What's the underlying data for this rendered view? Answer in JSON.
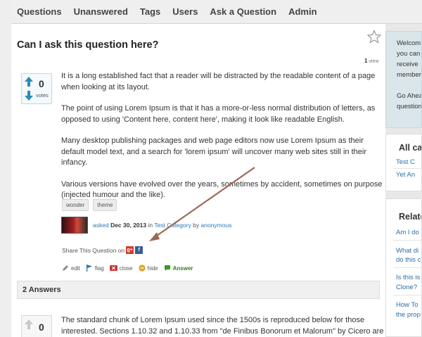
{
  "nav": {
    "items": [
      "Questions",
      "Unanswered",
      "Tags",
      "Users",
      "Ask a Question",
      "Admin"
    ]
  },
  "question": {
    "title": "Can I ask this question here?",
    "views_count": "1",
    "views_label": "view",
    "votes": "0",
    "votes_label": "votes",
    "paragraphs": [
      "It is a long established fact that a reader will be distracted by the readable content of a page when looking at its layout.",
      "The point of using Lorem Ipsum is that it has a more-or-less normal distribution of letters, as opposed to using 'Content here, content here', making it look like readable English.",
      "Many desktop publishing packages and web page editors now use Lorem Ipsum as their default model text, and a search for 'lorem ipsum' will uncover many web sites still in their infancy.",
      "Various versions have evolved over the years, sometimes by accident, sometimes on purpose (injected humour and the like)."
    ],
    "tags": [
      "wonder",
      "theme"
    ],
    "asked": {
      "label": "asked",
      "date": "Dec 30, 2013",
      "in": "in",
      "category": "Test Category",
      "by": "by",
      "user": "anonymous"
    },
    "share_label": "Share This Question on",
    "actions": {
      "edit": "edit",
      "flag": "flag",
      "close": "close",
      "hide": "hide",
      "answer": "Answer"
    }
  },
  "answers": {
    "header": "2 Answers",
    "first": {
      "votes": "0",
      "text": "The standard chunk of Lorem Ipsum used since the 1500s is reproduced below for those interested. Sections 1.10.32 and 1.10.33 from \"de Finibus Bonorum et Malorum\" by Cicero are"
    }
  },
  "sidebar": {
    "welcome_lines": [
      "Welcom",
      "you can",
      "receive",
      "member",
      "",
      "Go Ahea",
      "question"
    ],
    "categories": {
      "title": "All ca",
      "links": [
        "Test C",
        "Yet An"
      ]
    },
    "related": {
      "title": "Relate",
      "links": [
        "Am I do",
        "What di",
        "do this c",
        "Is this is",
        "Clone?",
        "How To",
        "the prop"
      ]
    }
  },
  "colors": {
    "link": "#2a7ab8",
    "answer_green": "#3a7b1a",
    "annotation_arrow": "#9a6a55",
    "vote_arrow": "#2a8ab8"
  }
}
